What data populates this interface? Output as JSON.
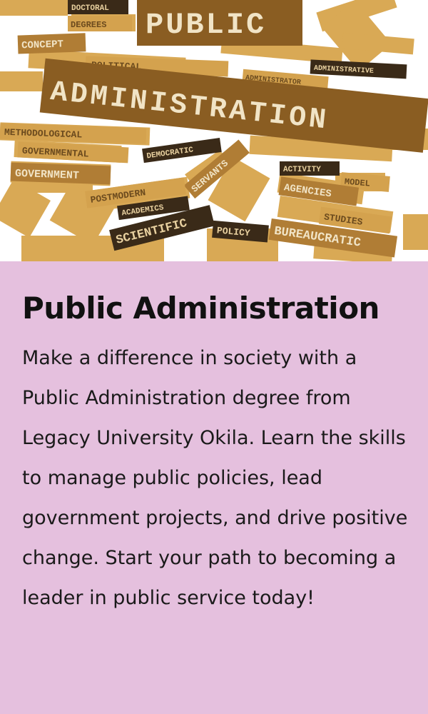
{
  "image": {
    "words": {
      "public": "PUBLIC",
      "administration": "ADMINISTRATION",
      "doctoral": "DOCTORAL",
      "degrees": "DEGREES",
      "concept": "CONCEPT",
      "political": "POLITICAL",
      "methodological": "METHODOLOGICAL",
      "governmental": "GOVERNMENTAL",
      "government": "GOVERNMENT",
      "democratic": "DEMOCRATIC",
      "servants": "SERVANTS",
      "activity": "ACTIVITY",
      "model": "MODEL",
      "agencies": "AGENCIES",
      "postmodern": "POSTMODERN",
      "academics": "ACADEMICS",
      "scientific": "SCIENTIFIC",
      "policy": "POLICY",
      "bureaucratic": "BUREAUCRATIC",
      "studies": "STUDIES",
      "administrative": "ADMINISTRATIVE",
      "administrator": "ADMINISTRATOR"
    }
  },
  "card": {
    "title": "Public Administration",
    "description": "Make a difference in society with a Public Administration degree from Legacy University Okila. Learn the skills to manage public policies, lead government projects, and drive positive change. Start your path to becoming a leader in public service today!"
  },
  "colors": {
    "background": "#e5c0de",
    "tag_light": "#d4a24e",
    "tag_dark": "#8a5d22",
    "tag_black": "#3a2a18",
    "text": "#111111"
  }
}
